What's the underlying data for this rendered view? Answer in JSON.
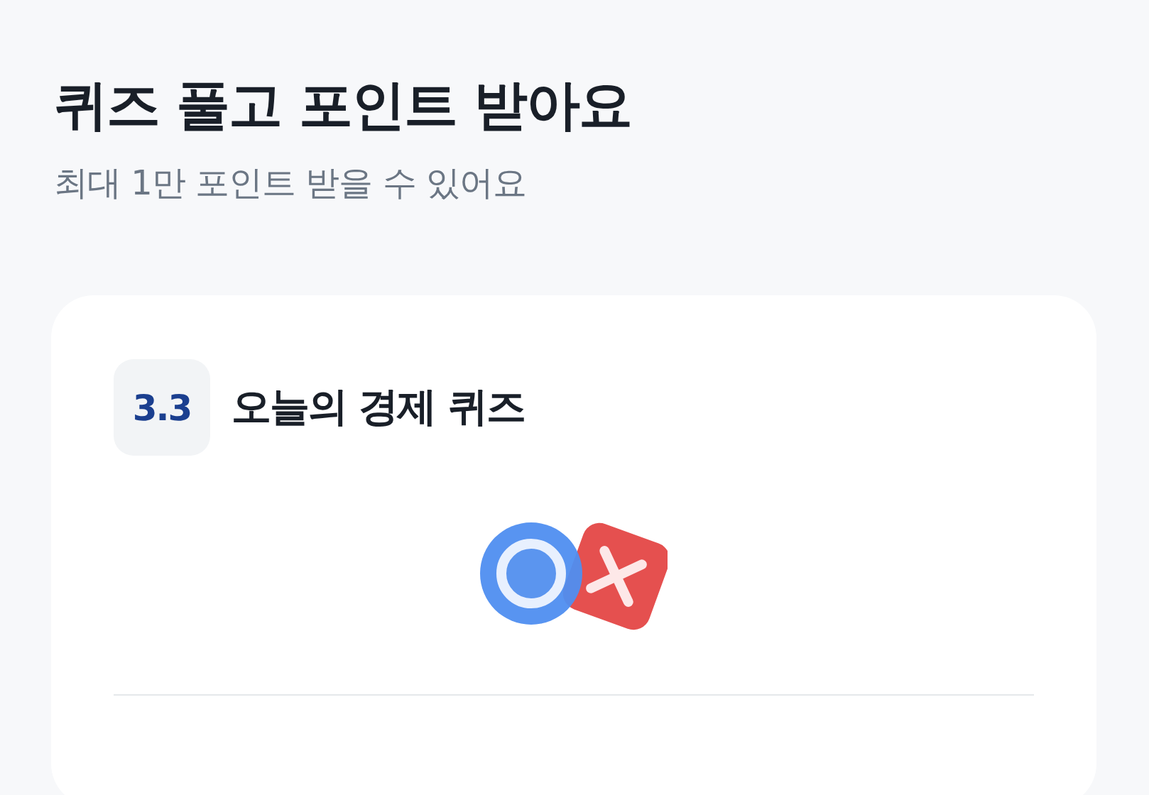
{
  "header": {
    "title": "퀴즈 풀고 포인트 받아요",
    "subtitle": "최대 1만 포인트 받을 수 있어요"
  },
  "quiz_card": {
    "logo": "3.3",
    "title": "오늘의 경제 퀴즈"
  }
}
